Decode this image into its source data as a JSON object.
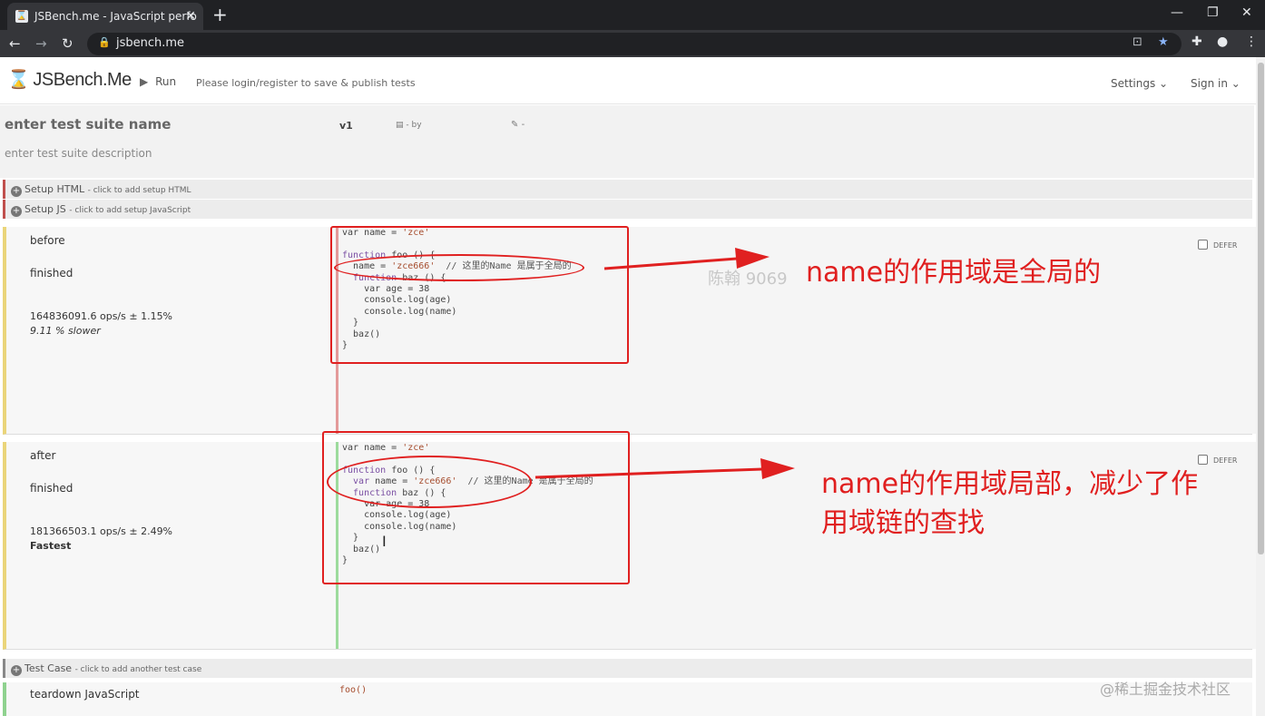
{
  "browser": {
    "tab_title": "JSBench.me - JavaScript perfo",
    "url": "jsbench.me"
  },
  "app": {
    "logo_text": "JSBench.Me",
    "run_label": "Run",
    "login_note": "Please login/register to save & publish tests",
    "settings_label": "Settings",
    "signin_label": "Sign in"
  },
  "suite": {
    "name_placeholder": "enter test suite name",
    "version": "v1",
    "by_label": "- by",
    "edit_label": "-",
    "description_placeholder": "enter test suite description"
  },
  "setup_html": {
    "label": "Setup HTML",
    "hint": "- click to add setup HTML"
  },
  "setup_js": {
    "label": "Setup JS",
    "hint": "- click to add setup JavaScript"
  },
  "cases": [
    {
      "title": "before",
      "status": "finished",
      "ops": "164836091.6 ops/s ± 1.15%",
      "relative": "9.11 % slower",
      "defer_label": "DEFER"
    },
    {
      "title": "after",
      "status": "finished",
      "ops": "181366503.1 ops/s ± 2.49%",
      "relative": "Fastest",
      "defer_label": "DEFER"
    }
  ],
  "code_before": {
    "l1": "var name = ",
    "l1s": "'zce'",
    "l2": "",
    "l3k": "function",
    "l3": " foo () {",
    "l4": "  name = ",
    "l4s": "'zce666'",
    "l4c": "  // 这里的Name 是属于全局的",
    "l5k": "  function",
    "l5": " baz () {",
    "l6": "    var age = 38",
    "l7": "    console.log(age)",
    "l8": "    console.log(name)",
    "l9": "  }",
    "l10": "  baz()",
    "l11": "}"
  },
  "code_after": {
    "l1": "var name = ",
    "l1s": "'zce'",
    "l2": "",
    "l3k": "function",
    "l3": " foo () {",
    "l4k": "  var",
    "l4": " name = ",
    "l4s": "'zce666'",
    "l4c": "  // 这里的Name 是属于全局的",
    "l5k": "  function",
    "l5": " baz () {",
    "l6": "    var age = 38",
    "l7": "    console.log(age)",
    "l8": "    console.log(name)",
    "l9": "  }",
    "l10": "  baz()",
    "l11": "}"
  },
  "test_case": {
    "label": "Test Case",
    "hint": "- click to add another test case"
  },
  "teardown": {
    "label": "teardown JavaScript",
    "code": "foo()"
  },
  "annotations": {
    "note1": "name的作用域是全局的",
    "note2_line1": "name的作用域局部，减少了作",
    "note2_line2": "用域链的查找",
    "watermark": "陈翰 9069",
    "corner_watermark": "@稀土掘金技术社区"
  },
  "colors": {
    "annotation_red": "#e02020"
  }
}
